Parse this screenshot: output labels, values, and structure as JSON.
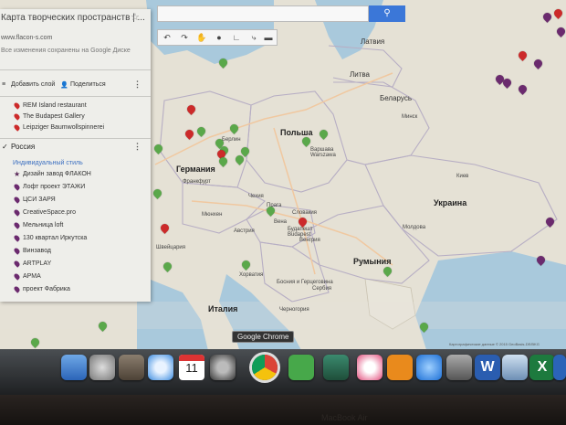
{
  "panel": {
    "title": "Карта творческих пространств | ...",
    "url": "www.flacon-s.com",
    "saved_text": "Все изменения сохранены на Google Диске",
    "add_layer": "Добавить слой",
    "share": "Поделиться",
    "layer1_items": [
      "REM Island restaurant",
      "The Budapest Gallery",
      "Leipziger Baumwollspinnerei"
    ],
    "layer2_title": "Россия",
    "layer2_style": "Индивидуальный стиль",
    "layer2_items": [
      "Дизайн завод ФЛАКОН",
      "Лофт проект ЭТАЖИ",
      "ЦСИ ЗАРЯ",
      "CreativeSpace.pro",
      "Мельница loft",
      "130 квартал Иркутска",
      "Винзавод",
      "ARTPLAY",
      "АРМА",
      "проект Фабрика"
    ]
  },
  "map": {
    "countries": {
      "latvia": "Латвия",
      "lithuania": "Литва",
      "belarus": "Беларусь",
      "poland": "Польша",
      "germany": "Германия",
      "ukraine": "Украина",
      "romania": "Румыния",
      "italy": "Италия",
      "austria": "Австрия",
      "hungary": "Венгрия",
      "czech": "Чехия",
      "slovakia": "Словакия",
      "moldova": "Молдова",
      "croatia": "Хорватия",
      "serbia": "Сербия",
      "bosnia": "Босния и Герцеговина",
      "switzerland": "Швейцария",
      "montenegro": "Черногория"
    },
    "cities": {
      "warsaw": "Варшава Warszawa",
      "berlin": "Берлин",
      "frankfurt": "Франкфурт",
      "munich": "Мюнхен",
      "prague": "Прага",
      "vienna": "Вена",
      "budapest": "Будапешт Budapest",
      "kyiv": "Киев",
      "minsk": "Минск"
    },
    "tooltip": "Google Chrome",
    "attribution": "Картографические данные © 2015 GeoBasis-DE/BKG"
  },
  "dock": {
    "calendar_day": "11"
  },
  "laptop": {
    "brand": "MacBook Air"
  },
  "colors": {
    "green_pin": "#5aa84a",
    "red_pin": "#cc2a2a",
    "purple_pin": "#6b2a6e",
    "map_land": "#e8e5da",
    "map_water": "#a9cbe0"
  }
}
